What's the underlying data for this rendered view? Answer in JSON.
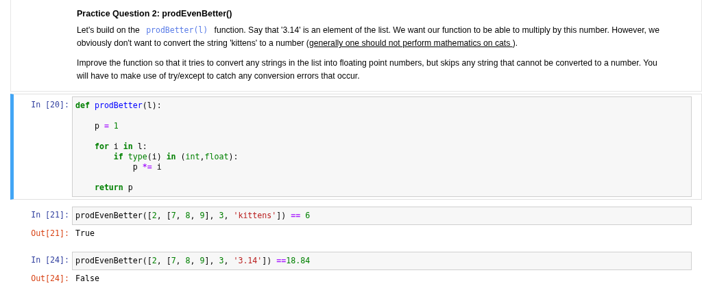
{
  "cells": [
    {
      "kind": "markdown",
      "selected": false,
      "heading": "Practice Question 2: prodEvenBetter()",
      "paragraphs": [
        [
          {
            "kind": "text",
            "text": "Let's build on the "
          },
          {
            "kind": "code",
            "text": "prodBetter(l)"
          },
          {
            "kind": "text",
            "text": " function. Say that '3.14' is an element of the list. We want our function to be able to multiply by this number. However, we obviously don't want to convert the string 'kittens' to a number ("
          },
          {
            "kind": "link",
            "text": "generally one should not perform mathematics on cats "
          },
          {
            "kind": "text",
            "text": ")."
          }
        ],
        [
          {
            "kind": "text",
            "text": "Improve the function so that it tries to convert any strings in the list into floating point numbers, but skips any string that cannot be converted to a number. You will have to make use of try/except to catch any conversion errors that occur."
          }
        ]
      ]
    },
    {
      "kind": "code",
      "selected": true,
      "prompt": "In [20]:",
      "blocks": [
        [
          [
            {
              "kind": "keyword",
              "text": "def"
            },
            {
              "kind": "defname",
              "text": " prodBetter"
            },
            {
              "kind": "plain",
              "text": "(l):"
            }
          ]
        ],
        [
          [
            {
              "kind": "plain",
              "text": "    p "
            },
            {
              "kind": "operator",
              "text": "="
            },
            {
              "kind": "number",
              "text": " 1"
            }
          ]
        ],
        [
          [
            {
              "kind": "keyword",
              "text": "    for"
            },
            {
              "kind": "plain",
              "text": " i "
            },
            {
              "kind": "keyword",
              "text": "in"
            },
            {
              "kind": "plain",
              "text": " l:"
            }
          ],
          [
            {
              "kind": "keyword",
              "text": "        if"
            },
            {
              "kind": "builtin",
              "text": " type"
            },
            {
              "kind": "plain",
              "text": "(i) "
            },
            {
              "kind": "keyword",
              "text": "in"
            },
            {
              "kind": "plain",
              "text": " ("
            },
            {
              "kind": "builtin",
              "text": "int"
            },
            {
              "kind": "plain",
              "text": ","
            },
            {
              "kind": "builtin",
              "text": "float"
            },
            {
              "kind": "plain",
              "text": "):"
            }
          ],
          [
            {
              "kind": "plain",
              "text": "            p "
            },
            {
              "kind": "operator",
              "text": "*="
            },
            {
              "kind": "plain",
              "text": " i"
            }
          ]
        ],
        [
          [
            {
              "kind": "keyword",
              "text": "    return"
            },
            {
              "kind": "plain",
              "text": " p"
            }
          ]
        ]
      ]
    },
    {
      "kind": "code",
      "selected": false,
      "prompt": "In [21]:",
      "blocks": [
        [
          [
            {
              "kind": "plain",
              "text": "prodEvenBetter(["
            },
            {
              "kind": "number",
              "text": "2"
            },
            {
              "kind": "plain",
              "text": ", ["
            },
            {
              "kind": "number",
              "text": "7"
            },
            {
              "kind": "plain",
              "text": ", "
            },
            {
              "kind": "number",
              "text": "8"
            },
            {
              "kind": "plain",
              "text": ", "
            },
            {
              "kind": "number",
              "text": "9"
            },
            {
              "kind": "plain",
              "text": "], "
            },
            {
              "kind": "number",
              "text": "3"
            },
            {
              "kind": "plain",
              "text": ", "
            },
            {
              "kind": "string",
              "text": "'kittens'"
            },
            {
              "kind": "plain",
              "text": "]) "
            },
            {
              "kind": "operator",
              "text": "=="
            },
            {
              "kind": "number",
              "text": " 6"
            }
          ]
        ]
      ],
      "output_prompt": "Out[21]:",
      "output": "True"
    },
    {
      "kind": "code",
      "selected": false,
      "prompt": "In [24]:",
      "blocks": [
        [
          [
            {
              "kind": "plain",
              "text": "prodEvenBetter(["
            },
            {
              "kind": "number",
              "text": "2"
            },
            {
              "kind": "plain",
              "text": ", ["
            },
            {
              "kind": "number",
              "text": "7"
            },
            {
              "kind": "plain",
              "text": ", "
            },
            {
              "kind": "number",
              "text": "8"
            },
            {
              "kind": "plain",
              "text": ", "
            },
            {
              "kind": "number",
              "text": "9"
            },
            {
              "kind": "plain",
              "text": "], "
            },
            {
              "kind": "number",
              "text": "3"
            },
            {
              "kind": "plain",
              "text": ", "
            },
            {
              "kind": "string",
              "text": "'3.14'"
            },
            {
              "kind": "plain",
              "text": "]) "
            },
            {
              "kind": "operator",
              "text": "=="
            },
            {
              "kind": "number",
              "text": "18.84"
            }
          ]
        ]
      ],
      "output_prompt": "Out[24]:",
      "output": "False"
    }
  ]
}
